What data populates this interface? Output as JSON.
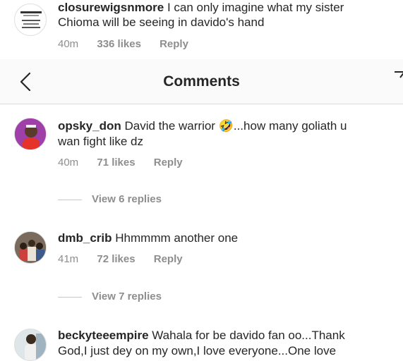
{
  "prev_comment": {
    "username": "closurewigsnmore",
    "text": "I can only imagine what my sister",
    "text2": "Chioma will be seeing in davido's hand",
    "time": "40m",
    "likes": "336 likes",
    "reply": "Reply"
  },
  "header": {
    "title": "Comments"
  },
  "comments": [
    {
      "username": "opsky_don",
      "text": "David the warrior 🤣...how many goliath u",
      "text2": "wan fight like dz",
      "time": "40m",
      "likes": "71 likes",
      "reply": "Reply",
      "view_replies": "View 6 replies"
    },
    {
      "username": "dmb_crib",
      "text": "Hhmmmm another one",
      "time": "41m",
      "likes": "72 likes",
      "reply": "Reply",
      "view_replies": "View 7 replies"
    },
    {
      "username": "beckyteeempire",
      "text": "Wahala for be davido fan oo...Thank",
      "text2": "God,I just dey on my own,I love everyone...One love"
    }
  ],
  "colors": {
    "text": "#262626",
    "muted": "#8e8e8e",
    "header_bg": "#fafafa"
  }
}
